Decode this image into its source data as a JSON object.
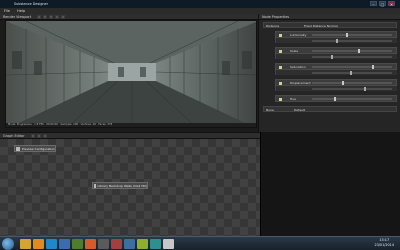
{
  "window": {
    "title": "Substance Designer",
    "controls": [
      "–",
      "□",
      "✕"
    ]
  },
  "menu": [
    "File",
    "Help"
  ],
  "viewport": {
    "title": "Render Viewport",
    "status": "Mode: Progressive · 1.8 FPS · 00:00:00 · Samples: 200 · Vertices: 16 · Faces: 376"
  },
  "properties": {
    "title": "Node Properties",
    "header": "Distance",
    "header_tag": "Fixed Distance Normal",
    "rows": [
      {
        "name": "Luminosity"
      },
      {
        "name": "Scale"
      },
      {
        "name": "Saturation"
      },
      {
        "name": "Displacement"
      },
      {
        "name": "Hue"
      }
    ],
    "footer_a": "None",
    "footer_b": "Default"
  },
  "graph": {
    "title": "Graph Editor",
    "nodes": [
      {
        "label": "Preview Configuration"
      },
      {
        "label": "Library Backdrop Walls (CG4 HD)"
      }
    ]
  },
  "taskbar": {
    "time": "13:17",
    "date": "23/01/2014",
    "colors": [
      "#d3a634",
      "#e28a1d",
      "#1e88c8",
      "#3b6bb0",
      "#4f7d2e",
      "#d65a2a",
      "#5a5a5a",
      "#a33f3f",
      "#3c6e9e",
      "#8fae2e",
      "#2f8e8e",
      "#c7c7c7"
    ]
  }
}
